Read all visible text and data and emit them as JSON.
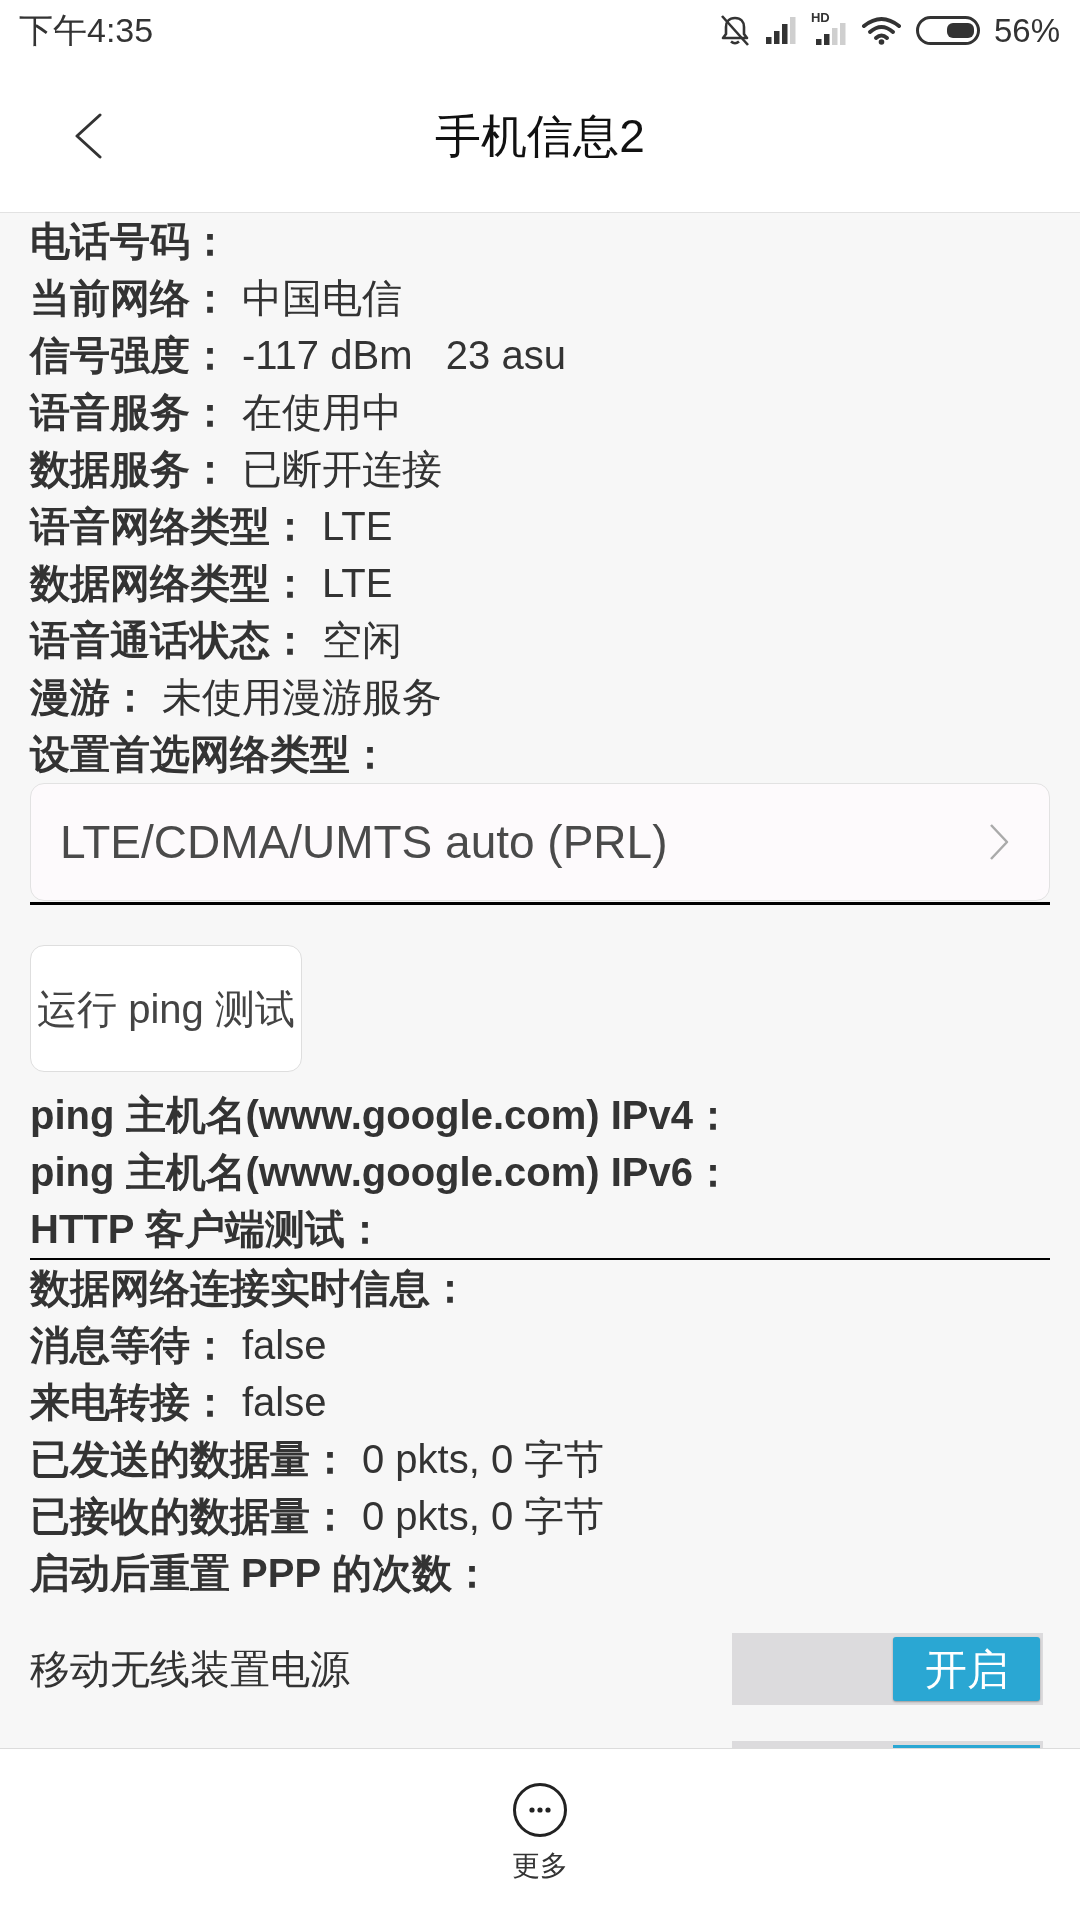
{
  "status_bar": {
    "time": "下午4:35",
    "network_badge": "HD",
    "battery": "56%"
  },
  "header": {
    "title": "手机信息2"
  },
  "info_rows": [
    {
      "label": "电话号码："
    },
    {
      "label": "当前网络：",
      "value": "中国电信"
    },
    {
      "label": "信号强度：",
      "value": "-117 dBm   23 asu"
    },
    {
      "label": "语音服务：",
      "value": "在使用中"
    },
    {
      "label": "数据服务：",
      "value": "已断开连接"
    },
    {
      "label": "语音网络类型：",
      "value": "LTE"
    },
    {
      "label": "数据网络类型：",
      "value": "LTE"
    },
    {
      "label": "语音通话状态：",
      "value": "空闲"
    },
    {
      "label": "漫游：",
      "value": "未使用漫游服务"
    },
    {
      "label": "设置首选网络类型："
    }
  ],
  "preferred_network": {
    "value": "LTE/CDMA/UMTS auto (PRL)"
  },
  "ping_button": {
    "label": "运行 ping 测试"
  },
  "ping_results": [
    {
      "label": "ping 主机名(www.google.com) IPv4："
    },
    {
      "label": "ping 主机名(www.google.com) IPv6："
    },
    {
      "label": "HTTP 客户端测试："
    }
  ],
  "data_rows": [
    {
      "label": "数据网络连接实时信息："
    },
    {
      "label": "消息等待：",
      "value": "false"
    },
    {
      "label": "来电转接：",
      "value": "false"
    },
    {
      "label": "已发送的数据量：",
      "value": "0 pkts, 0 字节"
    },
    {
      "label": "已接收的数据量：",
      "value": "0 pkts, 0 字节"
    },
    {
      "label": "启动后重置 PPP 的次数："
    }
  ],
  "toggles": [
    {
      "kind": "row",
      "label": "移动无线装置电源",
      "button": "开启",
      "on": true
    },
    {
      "kind": "cut",
      "on": true
    }
  ],
  "bottom_bar": {
    "more_label": "更多"
  }
}
